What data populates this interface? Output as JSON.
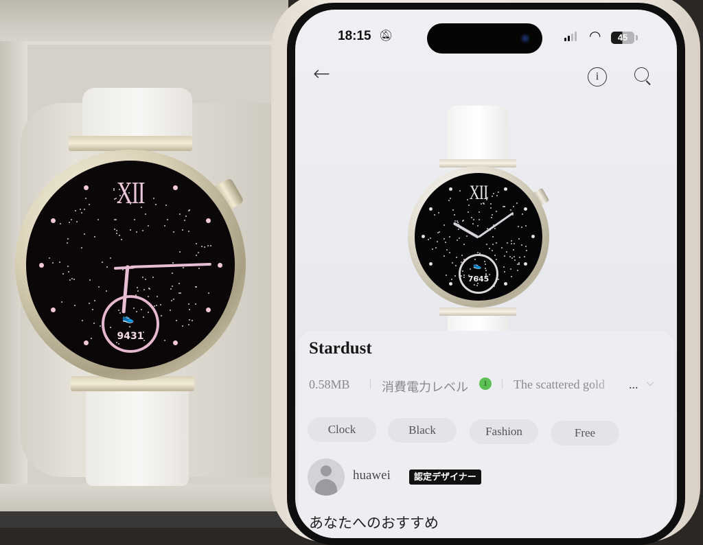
{
  "status_bar": {
    "time": "18:15",
    "mute_icon": "bell-slash-icon",
    "signal_icon": "cellular-signal-icon",
    "wifi_icon": "wifi-icon",
    "battery_level": "45"
  },
  "nav": {
    "back_icon": "←",
    "info_icon": "i",
    "search_icon": "search-icon"
  },
  "physical_watch": {
    "numeral": "XII",
    "steps": "9431"
  },
  "preview_watch": {
    "numeral": "XII",
    "steps": "7645"
  },
  "detail": {
    "title": "Stardust",
    "size": "0.58MB",
    "separator": "|",
    "power_label": "消費電力レベル",
    "power_level": "1",
    "power_color": "#5bbf55",
    "description": "The scattered gold",
    "more": "...",
    "expand_icon": "⌵",
    "tags": [
      "Clock",
      "Black",
      "Fashion",
      "Free"
    ]
  },
  "designer": {
    "name": "huawei",
    "badge": "認定デザイナー"
  },
  "recommend_title": "あなたへのおすすめ"
}
